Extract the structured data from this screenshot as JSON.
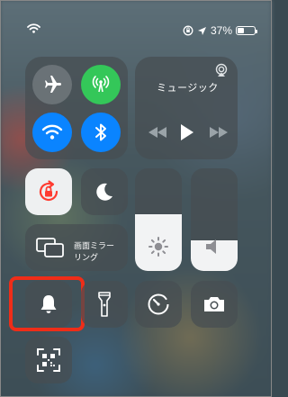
{
  "status_bar": {
    "battery_percent": "37%",
    "battery_level": 0.37
  },
  "connectivity": {
    "airplane": {
      "icon": "airplane-icon",
      "on": false
    },
    "cellular": {
      "icon": "antenna-icon",
      "on": true,
      "color": "#34c759"
    },
    "wifi": {
      "icon": "wifi-icon",
      "on": true,
      "color": "#0a84ff"
    },
    "bluetooth": {
      "icon": "bluetooth-icon",
      "on": true,
      "color": "#0a84ff"
    }
  },
  "music": {
    "title": "ミュージック",
    "icons": [
      "airplay-icon",
      "rewind-icon",
      "play-icon",
      "fast-forward-icon"
    ]
  },
  "controls": {
    "rotation_lock": {
      "icon": "rotation-lock-icon",
      "accent": "#ff3b30"
    },
    "dnd": {
      "icon": "moon-icon"
    },
    "screen_mirroring": {
      "label_line1": "画面ミラー",
      "label_line2": "リング",
      "icon": "screen-mirroring-icon"
    },
    "brightness": {
      "icon": "sun-icon",
      "level": 0.55
    },
    "volume": {
      "icon": "speaker-icon",
      "level": 0.3
    },
    "silent": {
      "icon": "bell-icon"
    },
    "flashlight": {
      "icon": "flashlight-icon"
    },
    "timer": {
      "icon": "timer-icon"
    },
    "camera": {
      "icon": "camera-icon"
    },
    "qr_scanner": {
      "icon": "qr-code-icon"
    }
  },
  "highlight_color": "#ef2d18"
}
